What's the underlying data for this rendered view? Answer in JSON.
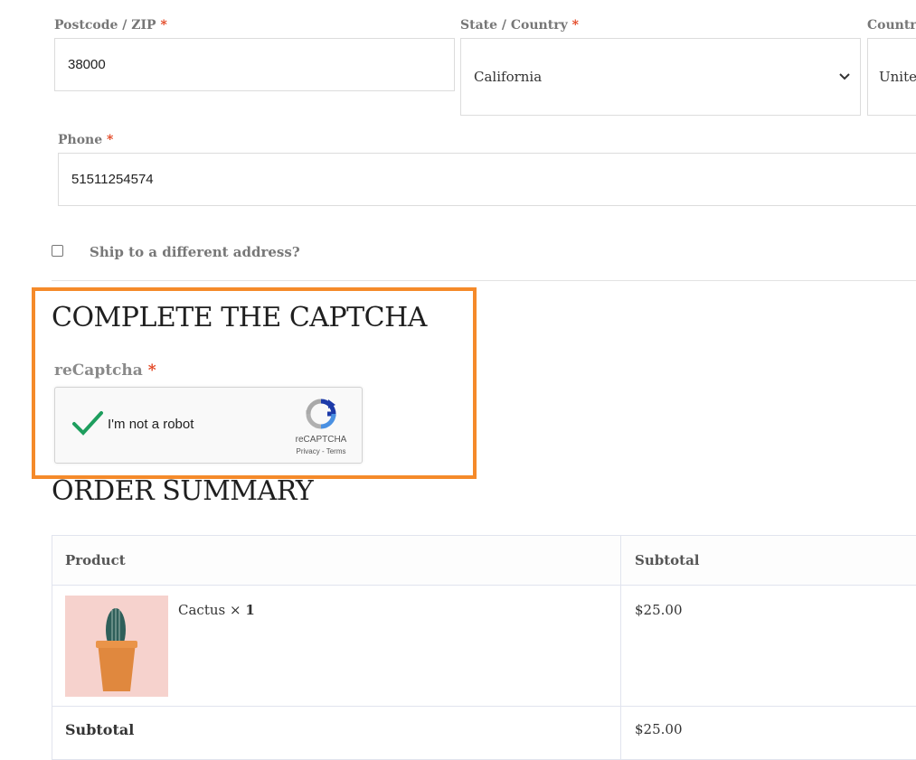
{
  "billing": {
    "postcode": {
      "label": "Postcode / ZIP",
      "required": "*",
      "value": "38000"
    },
    "state": {
      "label": "State / Country",
      "required": "*",
      "value": "California"
    },
    "country": {
      "label": "Country",
      "value": "Unite"
    },
    "phone": {
      "label": "Phone",
      "required": "*",
      "value": "51511254574"
    }
  },
  "ship_different": {
    "label": "Ship to a different address?"
  },
  "captcha_section": {
    "title": "COMPLETE THE CAPTCHA",
    "field_label": "reCaptcha",
    "required": "*",
    "widget": {
      "label": "I'm not a robot",
      "brand": "reCAPTCHA",
      "privacy": "Privacy",
      "separator": " - ",
      "terms": "Terms",
      "checked": true
    }
  },
  "order_summary": {
    "title": "ORDER SUMMARY",
    "headers": {
      "product": "Product",
      "subtotal": "Subtotal"
    },
    "items": [
      {
        "name": "Cactus",
        "qty_sep": " × ",
        "qty": "1",
        "subtotal": "$25.00",
        "image_icon": "cactus-pot"
      }
    ],
    "subtotal_row": {
      "label": "Subtotal",
      "value": "$25.00"
    }
  },
  "colors": {
    "highlight": "#f58a2a",
    "required": "#e2401c",
    "check": "#1e9e5e"
  }
}
